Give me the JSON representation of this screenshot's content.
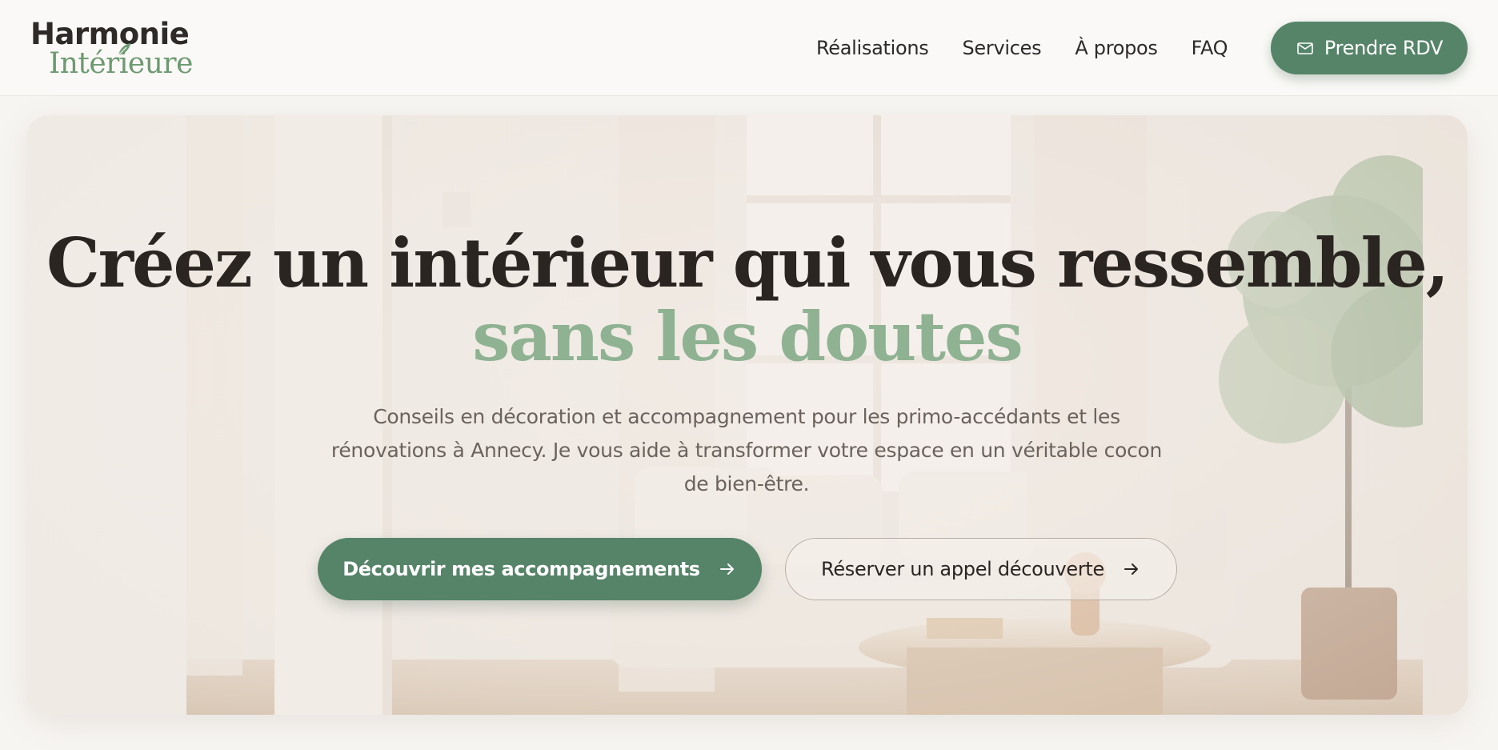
{
  "header": {
    "logo": {
      "line1": "Harmonie",
      "line2": "Intérieure"
    },
    "nav": [
      {
        "label": "Réalisations"
      },
      {
        "label": "Services"
      },
      {
        "label": "À propos"
      },
      {
        "label": "FAQ"
      }
    ],
    "cta": {
      "label": "Prendre RDV",
      "icon": "mail-icon"
    }
  },
  "hero": {
    "title_line1": "Créez un intérieur qui vous ressemble,",
    "title_line2": "sans les doutes",
    "subtitle": "Conseils en décoration et accompagnement pour les primo-accédants et les rénovations à Annecy. Je vous aide à transformer votre espace en un véritable cocon de bien-être.",
    "primary_button": {
      "label": "Découvrir mes accompagnements",
      "icon": "arrow-right-icon"
    },
    "secondary_button": {
      "label": "Réserver un appel découverte",
      "icon": "arrow-right-icon"
    },
    "background_image": "living-room-with-sofa-plant-window"
  },
  "colors": {
    "accent": "#558468",
    "accent_light": "#8fb292",
    "text_dark": "#2b2522",
    "text_muted": "#6b625d",
    "background": "#f7f5f2"
  }
}
